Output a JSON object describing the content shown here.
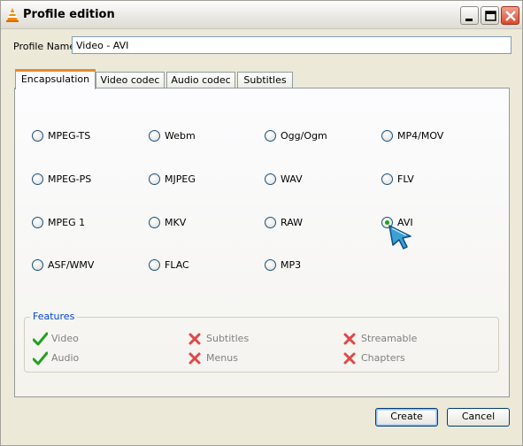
{
  "window": {
    "title": "Profile edition",
    "icon": "vlc-cone-icon",
    "controls": [
      "minimize-icon",
      "maximize-icon",
      "close-icon"
    ]
  },
  "profile": {
    "label": "Profile Name",
    "value": "Video - AVI"
  },
  "tabs": [
    {
      "label": "Encapsulation",
      "active": true
    },
    {
      "label": "Video codec",
      "active": false
    },
    {
      "label": "Audio codec",
      "active": false
    },
    {
      "label": "Subtitles",
      "active": false
    }
  ],
  "formats": [
    {
      "label": "MPEG-TS",
      "checked": false
    },
    {
      "label": "Webm",
      "checked": false
    },
    {
      "label": "Ogg/Ogm",
      "checked": false
    },
    {
      "label": "MP4/MOV",
      "checked": false
    },
    {
      "label": "MPEG-PS",
      "checked": false
    },
    {
      "label": "MJPEG",
      "checked": false
    },
    {
      "label": "WAV",
      "checked": false
    },
    {
      "label": "FLV",
      "checked": false
    },
    {
      "label": "MPEG 1",
      "checked": false
    },
    {
      "label": "MKV",
      "checked": false
    },
    {
      "label": "RAW",
      "checked": false
    },
    {
      "label": "AVI",
      "checked": true
    },
    {
      "label": "ASF/WMV",
      "checked": false
    },
    {
      "label": "FLAC",
      "checked": false
    },
    {
      "label": "MP3",
      "checked": false
    }
  ],
  "features": {
    "title": "Features",
    "items": [
      {
        "label": "Video",
        "supported": true
      },
      {
        "label": "Subtitles",
        "supported": false
      },
      {
        "label": "Streamable",
        "supported": false
      },
      {
        "label": "Audio",
        "supported": true
      },
      {
        "label": "Menus",
        "supported": false
      },
      {
        "label": "Chapters",
        "supported": false
      }
    ]
  },
  "buttons": {
    "create": "Create",
    "cancel": "Cancel"
  },
  "colors": {
    "check": "#21a121",
    "cross": "#e04848",
    "tab_accent": "#e68b2c",
    "group_title": "#0046d5"
  }
}
